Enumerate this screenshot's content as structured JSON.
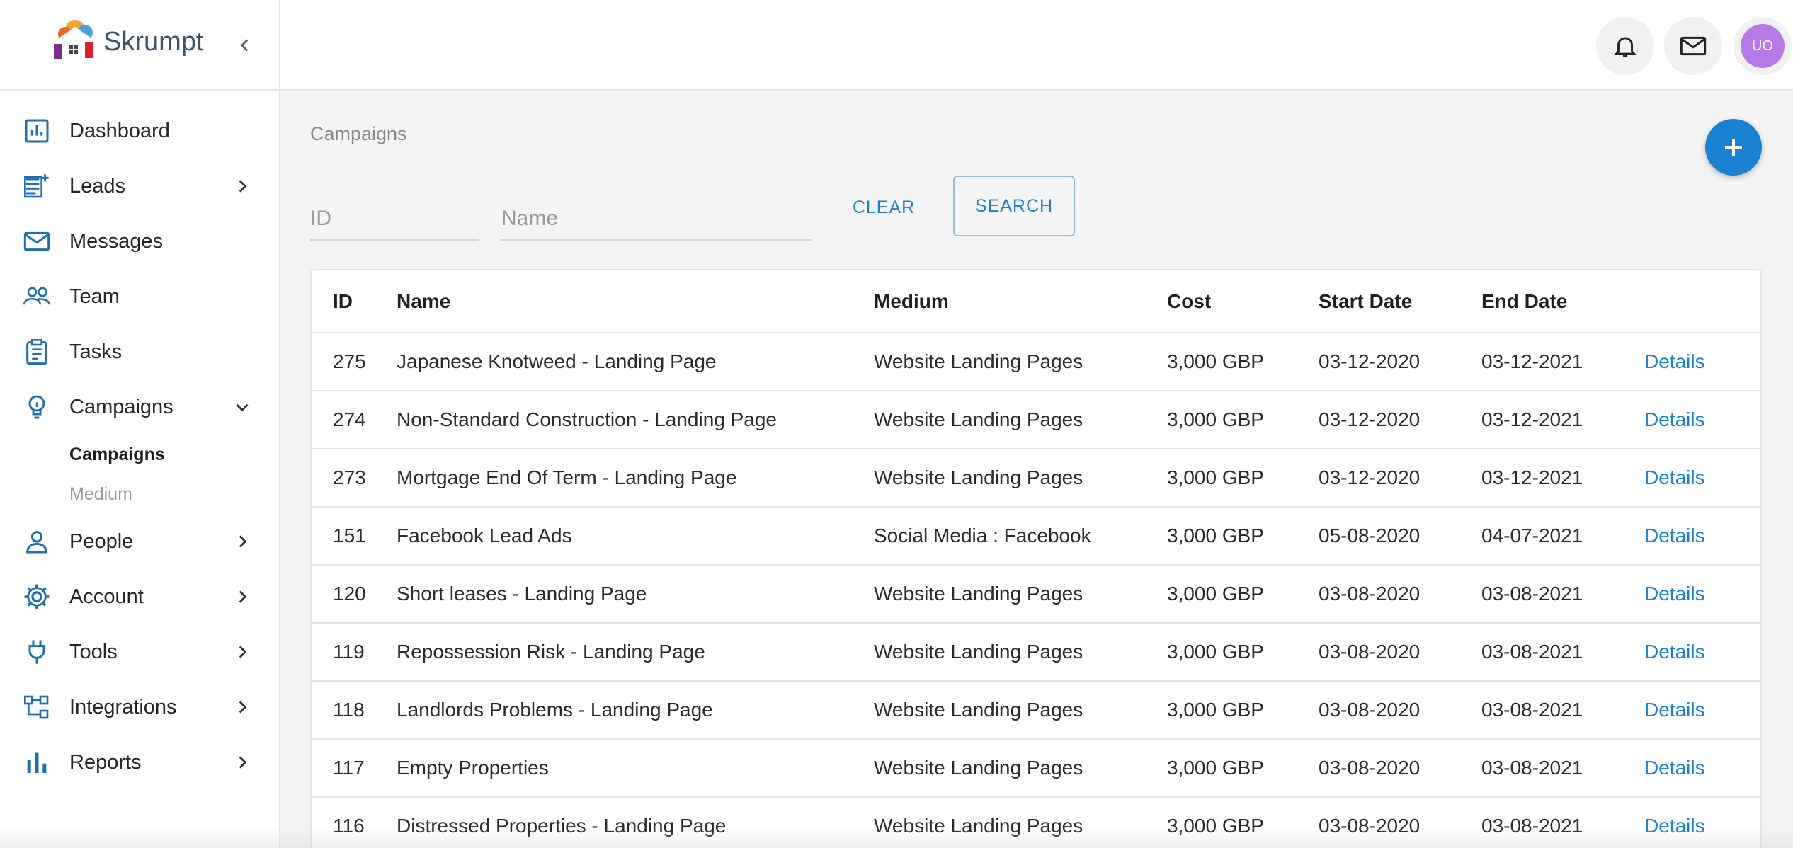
{
  "app": {
    "brand_name": "Skrumpt",
    "colors": {
      "accent": "#1a82d0",
      "avatar": "#b57ae8",
      "icon": "#1f6fb0"
    }
  },
  "topbar": {
    "notifications_icon": "bell-icon",
    "messages_icon": "mail-icon",
    "avatar_initials": "UO"
  },
  "sidebar": {
    "items": [
      {
        "label": "Dashboard",
        "icon": "dashboard-chart-icon",
        "chevron": ""
      },
      {
        "label": "Leads",
        "icon": "leads-icon",
        "chevron": "right"
      },
      {
        "label": "Messages",
        "icon": "mail-icon",
        "chevron": ""
      },
      {
        "label": "Team",
        "icon": "people-icon",
        "chevron": ""
      },
      {
        "label": "Tasks",
        "icon": "clipboard-icon",
        "chevron": ""
      },
      {
        "label": "Campaigns",
        "icon": "lightbulb-icon",
        "chevron": "down"
      },
      {
        "label": "People",
        "icon": "person-icon",
        "chevron": "right"
      },
      {
        "label": "Account",
        "icon": "gear-icon",
        "chevron": "right"
      },
      {
        "label": "Tools",
        "icon": "plug-icon",
        "chevron": "right"
      },
      {
        "label": "Integrations",
        "icon": "hierarchy-icon",
        "chevron": "right"
      },
      {
        "label": "Reports",
        "icon": "bar-chart-icon",
        "chevron": "right"
      }
    ],
    "campaign_sub": [
      "Campaigns",
      "Medium"
    ]
  },
  "main": {
    "breadcrumb": "Campaigns",
    "filters": {
      "id_placeholder": "ID",
      "name_placeholder": "Name",
      "clear_label": "CLEAR",
      "search_label": "SEARCH"
    },
    "table": {
      "columns": [
        "ID",
        "Name",
        "Medium",
        "Cost",
        "Start Date",
        "End Date"
      ],
      "rows": [
        {
          "id": "275",
          "name": "Japanese Knotweed - Landing Page",
          "medium": "Website Landing Pages",
          "cost": "3,000 GBP",
          "start": "03-12-2020",
          "end": "03-12-2021",
          "action": "Details"
        },
        {
          "id": "274",
          "name": "Non-Standard Construction - Landing Page",
          "medium": "Website Landing Pages",
          "cost": "3,000 GBP",
          "start": "03-12-2020",
          "end": "03-12-2021",
          "action": "Details"
        },
        {
          "id": "273",
          "name": "Mortgage End Of Term - Landing Page",
          "medium": "Website Landing Pages",
          "cost": "3,000 GBP",
          "start": "03-12-2020",
          "end": "03-12-2021",
          "action": "Details"
        },
        {
          "id": "151",
          "name": "Facebook Lead Ads",
          "medium": "Social Media : Facebook",
          "cost": "3,000 GBP",
          "start": "05-08-2020",
          "end": "04-07-2021",
          "action": "Details"
        },
        {
          "id": "120",
          "name": "Short leases - Landing Page",
          "medium": "Website Landing Pages",
          "cost": "3,000 GBP",
          "start": "03-08-2020",
          "end": "03-08-2021",
          "action": "Details"
        },
        {
          "id": "119",
          "name": "Repossession Risk - Landing Page",
          "medium": "Website Landing Pages",
          "cost": "3,000 GBP",
          "start": "03-08-2020",
          "end": "03-08-2021",
          "action": "Details"
        },
        {
          "id": "118",
          "name": "Landlords Problems - Landing Page",
          "medium": "Website Landing Pages",
          "cost": "3,000 GBP",
          "start": "03-08-2020",
          "end": "03-08-2021",
          "action": "Details"
        },
        {
          "id": "117",
          "name": "Empty Properties",
          "medium": "Website Landing Pages",
          "cost": "3,000 GBP",
          "start": "03-08-2020",
          "end": "03-08-2021",
          "action": "Details"
        },
        {
          "id": "116",
          "name": "Distressed Properties - Landing Page",
          "medium": "Website Landing Pages",
          "cost": "3,000 GBP",
          "start": "03-08-2020",
          "end": "03-08-2021",
          "action": "Details"
        }
      ]
    }
  }
}
